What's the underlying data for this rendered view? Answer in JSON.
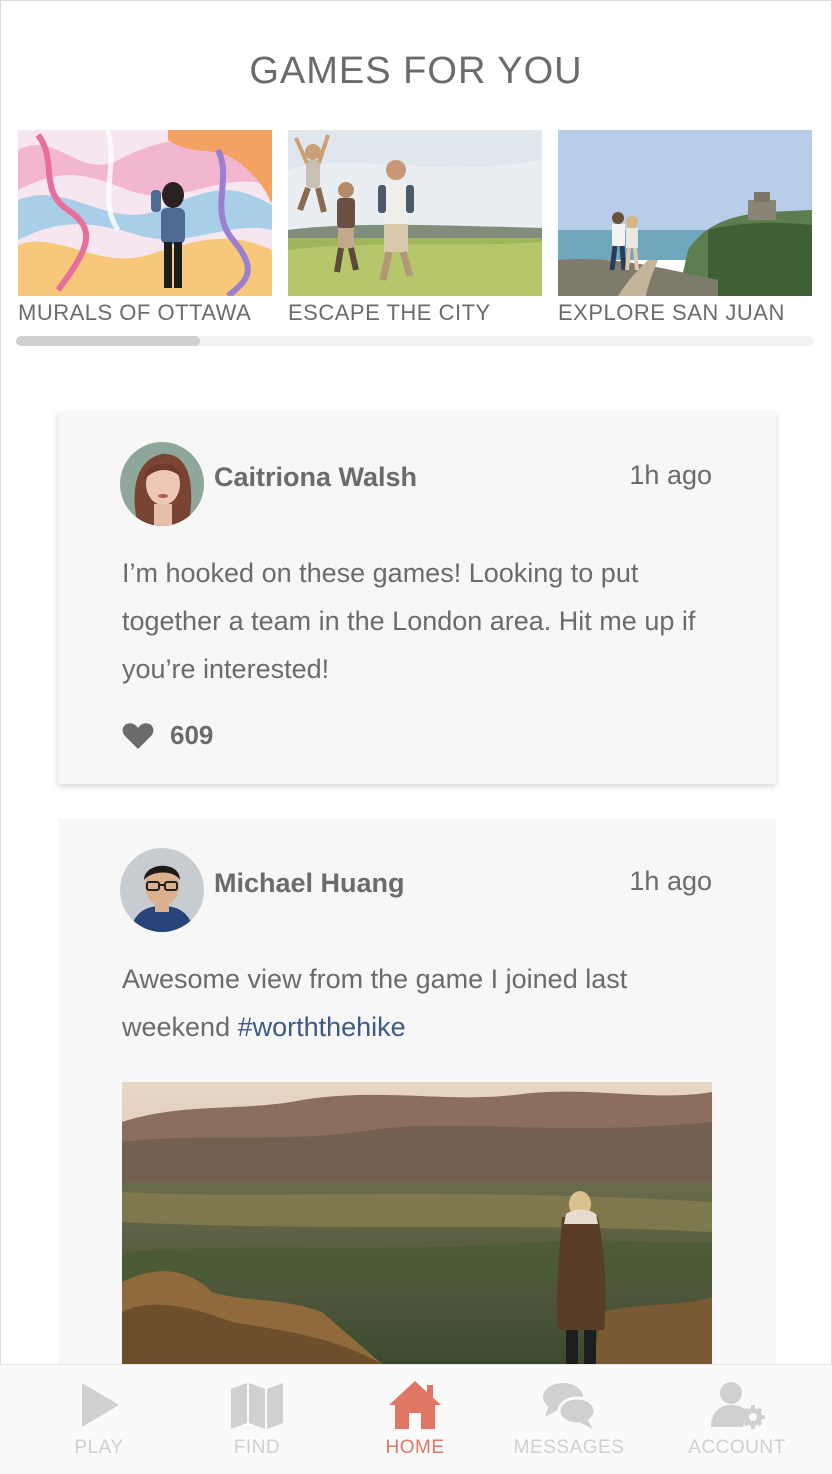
{
  "section": {
    "title": "GAMES FOR YOU"
  },
  "games": [
    {
      "label": "MURALS OF OTTAWA"
    },
    {
      "label": "ESCAPE THE CITY"
    },
    {
      "label": "EXPLORE SAN JUAN"
    }
  ],
  "carousel": {
    "scroll_progress": 0.23
  },
  "posts": [
    {
      "author": "Caitriona Walsh",
      "time": "1h ago",
      "text": "I’m hooked on these games! Looking to put together a team in the London area. Hit me up if you’re interested!",
      "likes": "609"
    },
    {
      "author": "Michael Huang",
      "time": "1h ago",
      "text": "Awesome view from the game I joined last weekend ",
      "hashtag": "#worththehike"
    }
  ],
  "nav": {
    "items": [
      {
        "label": "PLAY",
        "icon": "play-icon"
      },
      {
        "label": "FIND",
        "icon": "map-icon"
      },
      {
        "label": "HOME",
        "icon": "home-icon",
        "active": true
      },
      {
        "label": "MESSAGES",
        "icon": "messages-icon"
      },
      {
        "label": "ACCOUNT",
        "icon": "account-settings-icon"
      }
    ]
  },
  "colors": {
    "accent": "#e07765",
    "hashtag": "#3e5a84",
    "text": "#6b6b6b",
    "nav_inactive": "#d0d0d0"
  }
}
